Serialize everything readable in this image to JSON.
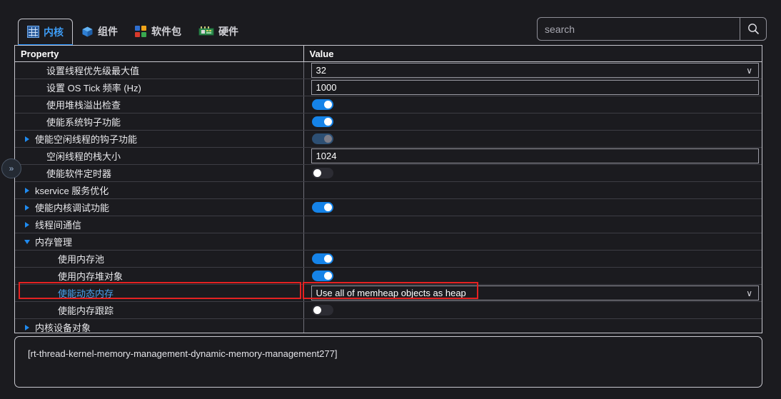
{
  "tabs": [
    {
      "id": "kernel",
      "label": "内核",
      "icon": "grid-icon",
      "active": true
    },
    {
      "id": "component",
      "label": "组件",
      "icon": "cube-icon",
      "active": false
    },
    {
      "id": "package",
      "label": "软件包",
      "icon": "packages-icon",
      "active": false
    },
    {
      "id": "hardware",
      "label": "硬件",
      "icon": "chip-icon",
      "active": false
    }
  ],
  "search": {
    "value": "",
    "placeholder": "search",
    "button_icon": "search-icon"
  },
  "table": {
    "headers": {
      "property": "Property",
      "value": "Value"
    },
    "rows": [
      {
        "label": "设置线程优先级最大值",
        "indent": 1,
        "arrow": "none",
        "widget": "combo",
        "value": "32",
        "highlight": false
      },
      {
        "label": "设置 OS Tick 频率 (Hz)",
        "indent": 1,
        "arrow": "none",
        "widget": "text",
        "value": "1000",
        "highlight": false
      },
      {
        "label": "使用堆栈溢出检查",
        "indent": 1,
        "arrow": "none",
        "widget": "switch",
        "state": "on",
        "highlight": false
      },
      {
        "label": "使能系统钩子功能",
        "indent": 1,
        "arrow": "none",
        "widget": "switch",
        "state": "on",
        "highlight": false
      },
      {
        "label": "使能空闲线程的钩子功能",
        "indent": 0,
        "arrow": "right",
        "widget": "switch",
        "state": "disabled",
        "highlight": false
      },
      {
        "label": "空闲线程的栈大小",
        "indent": 1,
        "arrow": "none",
        "widget": "text",
        "value": "1024",
        "highlight": false
      },
      {
        "label": "使能软件定时器",
        "indent": 1,
        "arrow": "none",
        "widget": "switch",
        "state": "off",
        "highlight": false
      },
      {
        "label": "kservice 服务优化",
        "indent": 0,
        "arrow": "right",
        "widget": "none",
        "highlight": false
      },
      {
        "label": "使能内核调试功能",
        "indent": 0,
        "arrow": "right",
        "widget": "switch",
        "state": "on",
        "highlight": false
      },
      {
        "label": "线程间通信",
        "indent": 0,
        "arrow": "right",
        "widget": "none",
        "highlight": false
      },
      {
        "label": "内存管理",
        "indent": 0,
        "arrow": "down",
        "widget": "none",
        "highlight": false
      },
      {
        "label": "使用内存池",
        "indent": 2,
        "arrow": "none",
        "widget": "switch",
        "state": "on",
        "highlight": false
      },
      {
        "label": "使用内存堆对象",
        "indent": 2,
        "arrow": "none",
        "widget": "switch",
        "state": "on",
        "highlight": false
      },
      {
        "label": "使能动态内存",
        "indent": 2,
        "arrow": "none",
        "widget": "combo",
        "value": "Use all of memheap objects as heap",
        "highlight": true
      },
      {
        "label": "使能内存跟踪",
        "indent": 2,
        "arrow": "none",
        "widget": "switch",
        "state": "off",
        "highlight": false
      },
      {
        "label": "内核设备对象",
        "indent": 0,
        "arrow": "right",
        "widget": "none",
        "highlight": false
      }
    ]
  },
  "description": {
    "text": "[rt-thread-kernel-memory-management-dynamic-memory-management277]"
  },
  "side_handle": {
    "icon": "chevron-double-right-icon",
    "glyph": "»"
  },
  "colors": {
    "background": "#1b1b1f",
    "accent_blue": "#1583e8",
    "tab_active": "#3d9cf5",
    "highlight_red": "#e52222",
    "border": "#c8c8cf",
    "scrollbar": "#cfd4e0"
  }
}
